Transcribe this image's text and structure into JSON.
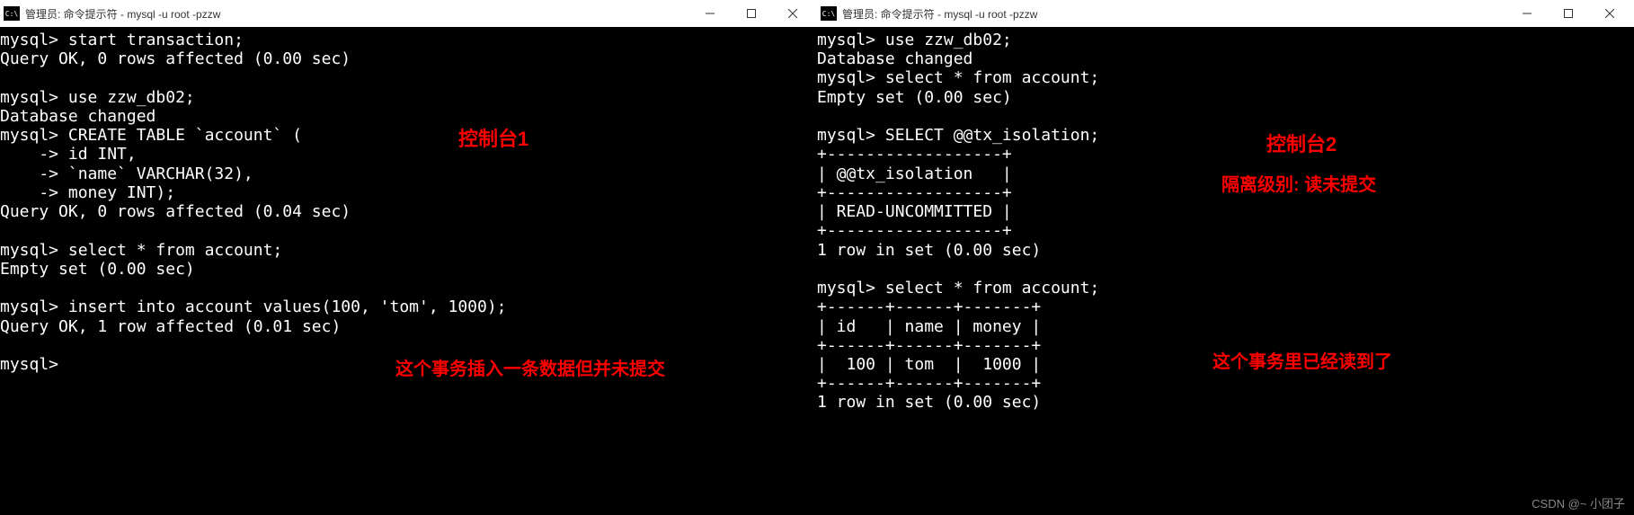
{
  "window1": {
    "title": "管理员: 命令提示符 - mysql  -u root -pzzw",
    "icon_text": "C:\\",
    "terminal_content": "mysql> start transaction;\nQuery OK, 0 rows affected (0.00 sec)\n\nmysql> use zzw_db02;\nDatabase changed\nmysql> CREATE TABLE `account` (\n    -> id INT,\n    -> `name` VARCHAR(32),\n    -> money INT);\nQuery OK, 0 rows affected (0.04 sec)\n\nmysql> select * from account;\nEmpty set (0.00 sec)\n\nmysql> insert into account values(100, 'tom', 1000);\nQuery OK, 1 row affected (0.01 sec)\n\nmysql>",
    "annotation1": "控制台1",
    "annotation2": "这个事务插入一条数据但并未提交"
  },
  "window2": {
    "title": "管理员: 命令提示符 - mysql  -u root -pzzw",
    "icon_text": "C:\\",
    "terminal_content": "mysql> use zzw_db02;\nDatabase changed\nmysql> select * from account;\nEmpty set (0.00 sec)\n\nmysql> SELECT @@tx_isolation;\n+------------------+\n| @@tx_isolation   |\n+------------------+\n| READ-UNCOMMITTED |\n+------------------+\n1 row in set (0.00 sec)\n\nmysql> select * from account;\n+------+------+-------+\n| id   | name | money |\n+------+------+-------+\n|  100 | tom  |  1000 |\n+------+------+-------+\n1 row in set (0.00 sec)",
    "annotation1": "控制台2",
    "annotation2": "隔离级别: 读未提交",
    "annotation3": "这个事务里已经读到了"
  },
  "watermark": "CSDN @~ 小团子"
}
